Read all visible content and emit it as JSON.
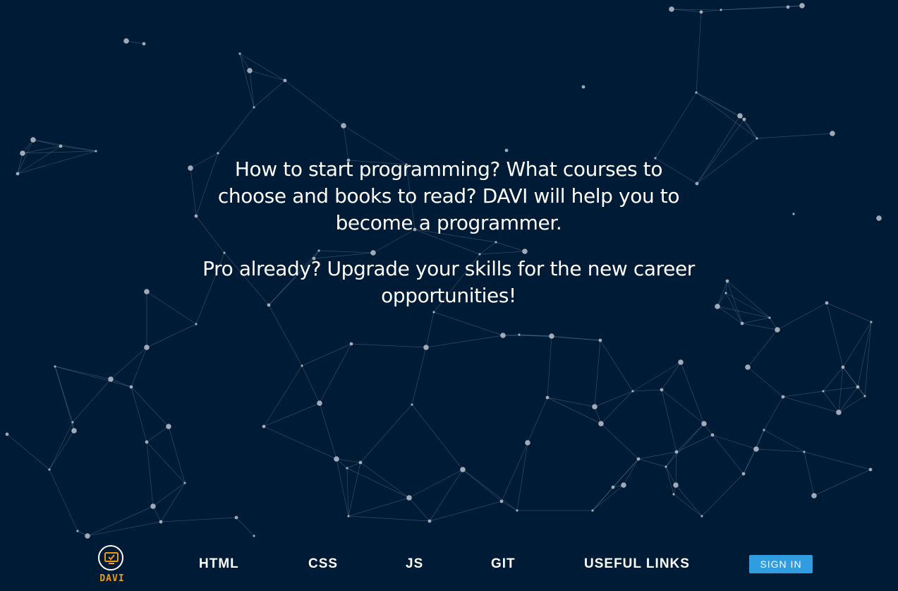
{
  "hero": {
    "line1": "How to start programming? What courses to choose and books to read? DAVI will help you to become a programmer.",
    "line2": "Pro already? Upgrade your skills for the new career opportunities!"
  },
  "nav": {
    "logo_text": "DAVI",
    "logo_icon": "monitor-check-icon",
    "items": [
      {
        "label": "HTML"
      },
      {
        "label": "CSS"
      },
      {
        "label": "JS"
      },
      {
        "label": "GIT"
      },
      {
        "label": "USEFUL LINKS"
      }
    ],
    "signin_label": "SIGN IN"
  },
  "colors": {
    "background": "#001b35",
    "accent": "#2f9de0",
    "logo": "#f39a12",
    "text": "#ffffff"
  }
}
